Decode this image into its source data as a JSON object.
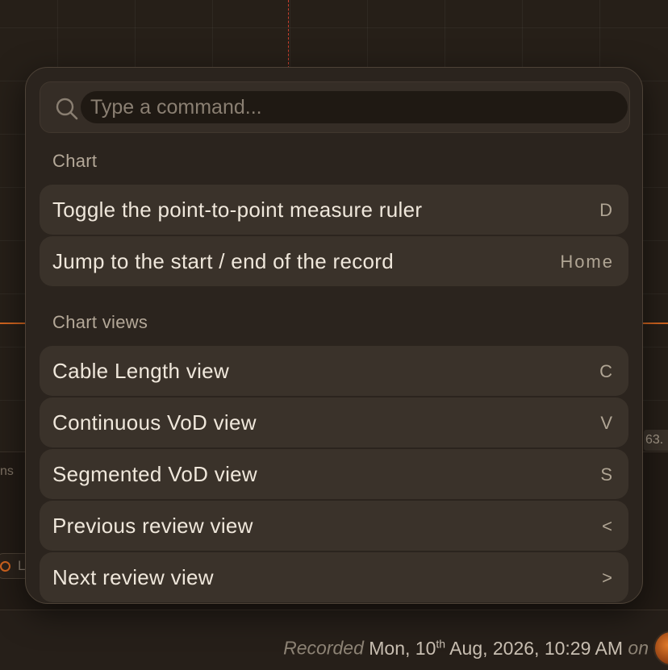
{
  "background": {
    "axis_value": "63.",
    "left_label": "ns",
    "left_badge_text": "L"
  },
  "footer": {
    "recorded_label": "Recorded",
    "date_prefix": "Mon, 10",
    "date_suffix": "th",
    "date_rest": " Aug, 2026, 10:29 AM",
    "on_label": "on"
  },
  "palette": {
    "search": {
      "placeholder": "Type a command...",
      "value": ""
    },
    "sections": [
      {
        "header": "Chart",
        "items": [
          {
            "label": "Toggle the point-to-point measure ruler",
            "shortcut": "D"
          },
          {
            "label": "Jump to the start / end of the record",
            "shortcut": "Home"
          }
        ]
      },
      {
        "header": "Chart views",
        "items": [
          {
            "label": "Cable Length view",
            "shortcut": "C"
          },
          {
            "label": "Continuous VoD view",
            "shortcut": "V"
          },
          {
            "label": "Segmented VoD view",
            "shortcut": "S"
          },
          {
            "label": "Previous review view",
            "shortcut": "<"
          },
          {
            "label": "Next review view",
            "shortcut": ">"
          }
        ]
      }
    ]
  },
  "colors": {
    "accent_orange": "#d0641f",
    "cursor_red": "#c8402e",
    "palette_bg": "#2b241e",
    "item_bg": "#3a322a"
  },
  "icons": {
    "search": "search-icon"
  }
}
